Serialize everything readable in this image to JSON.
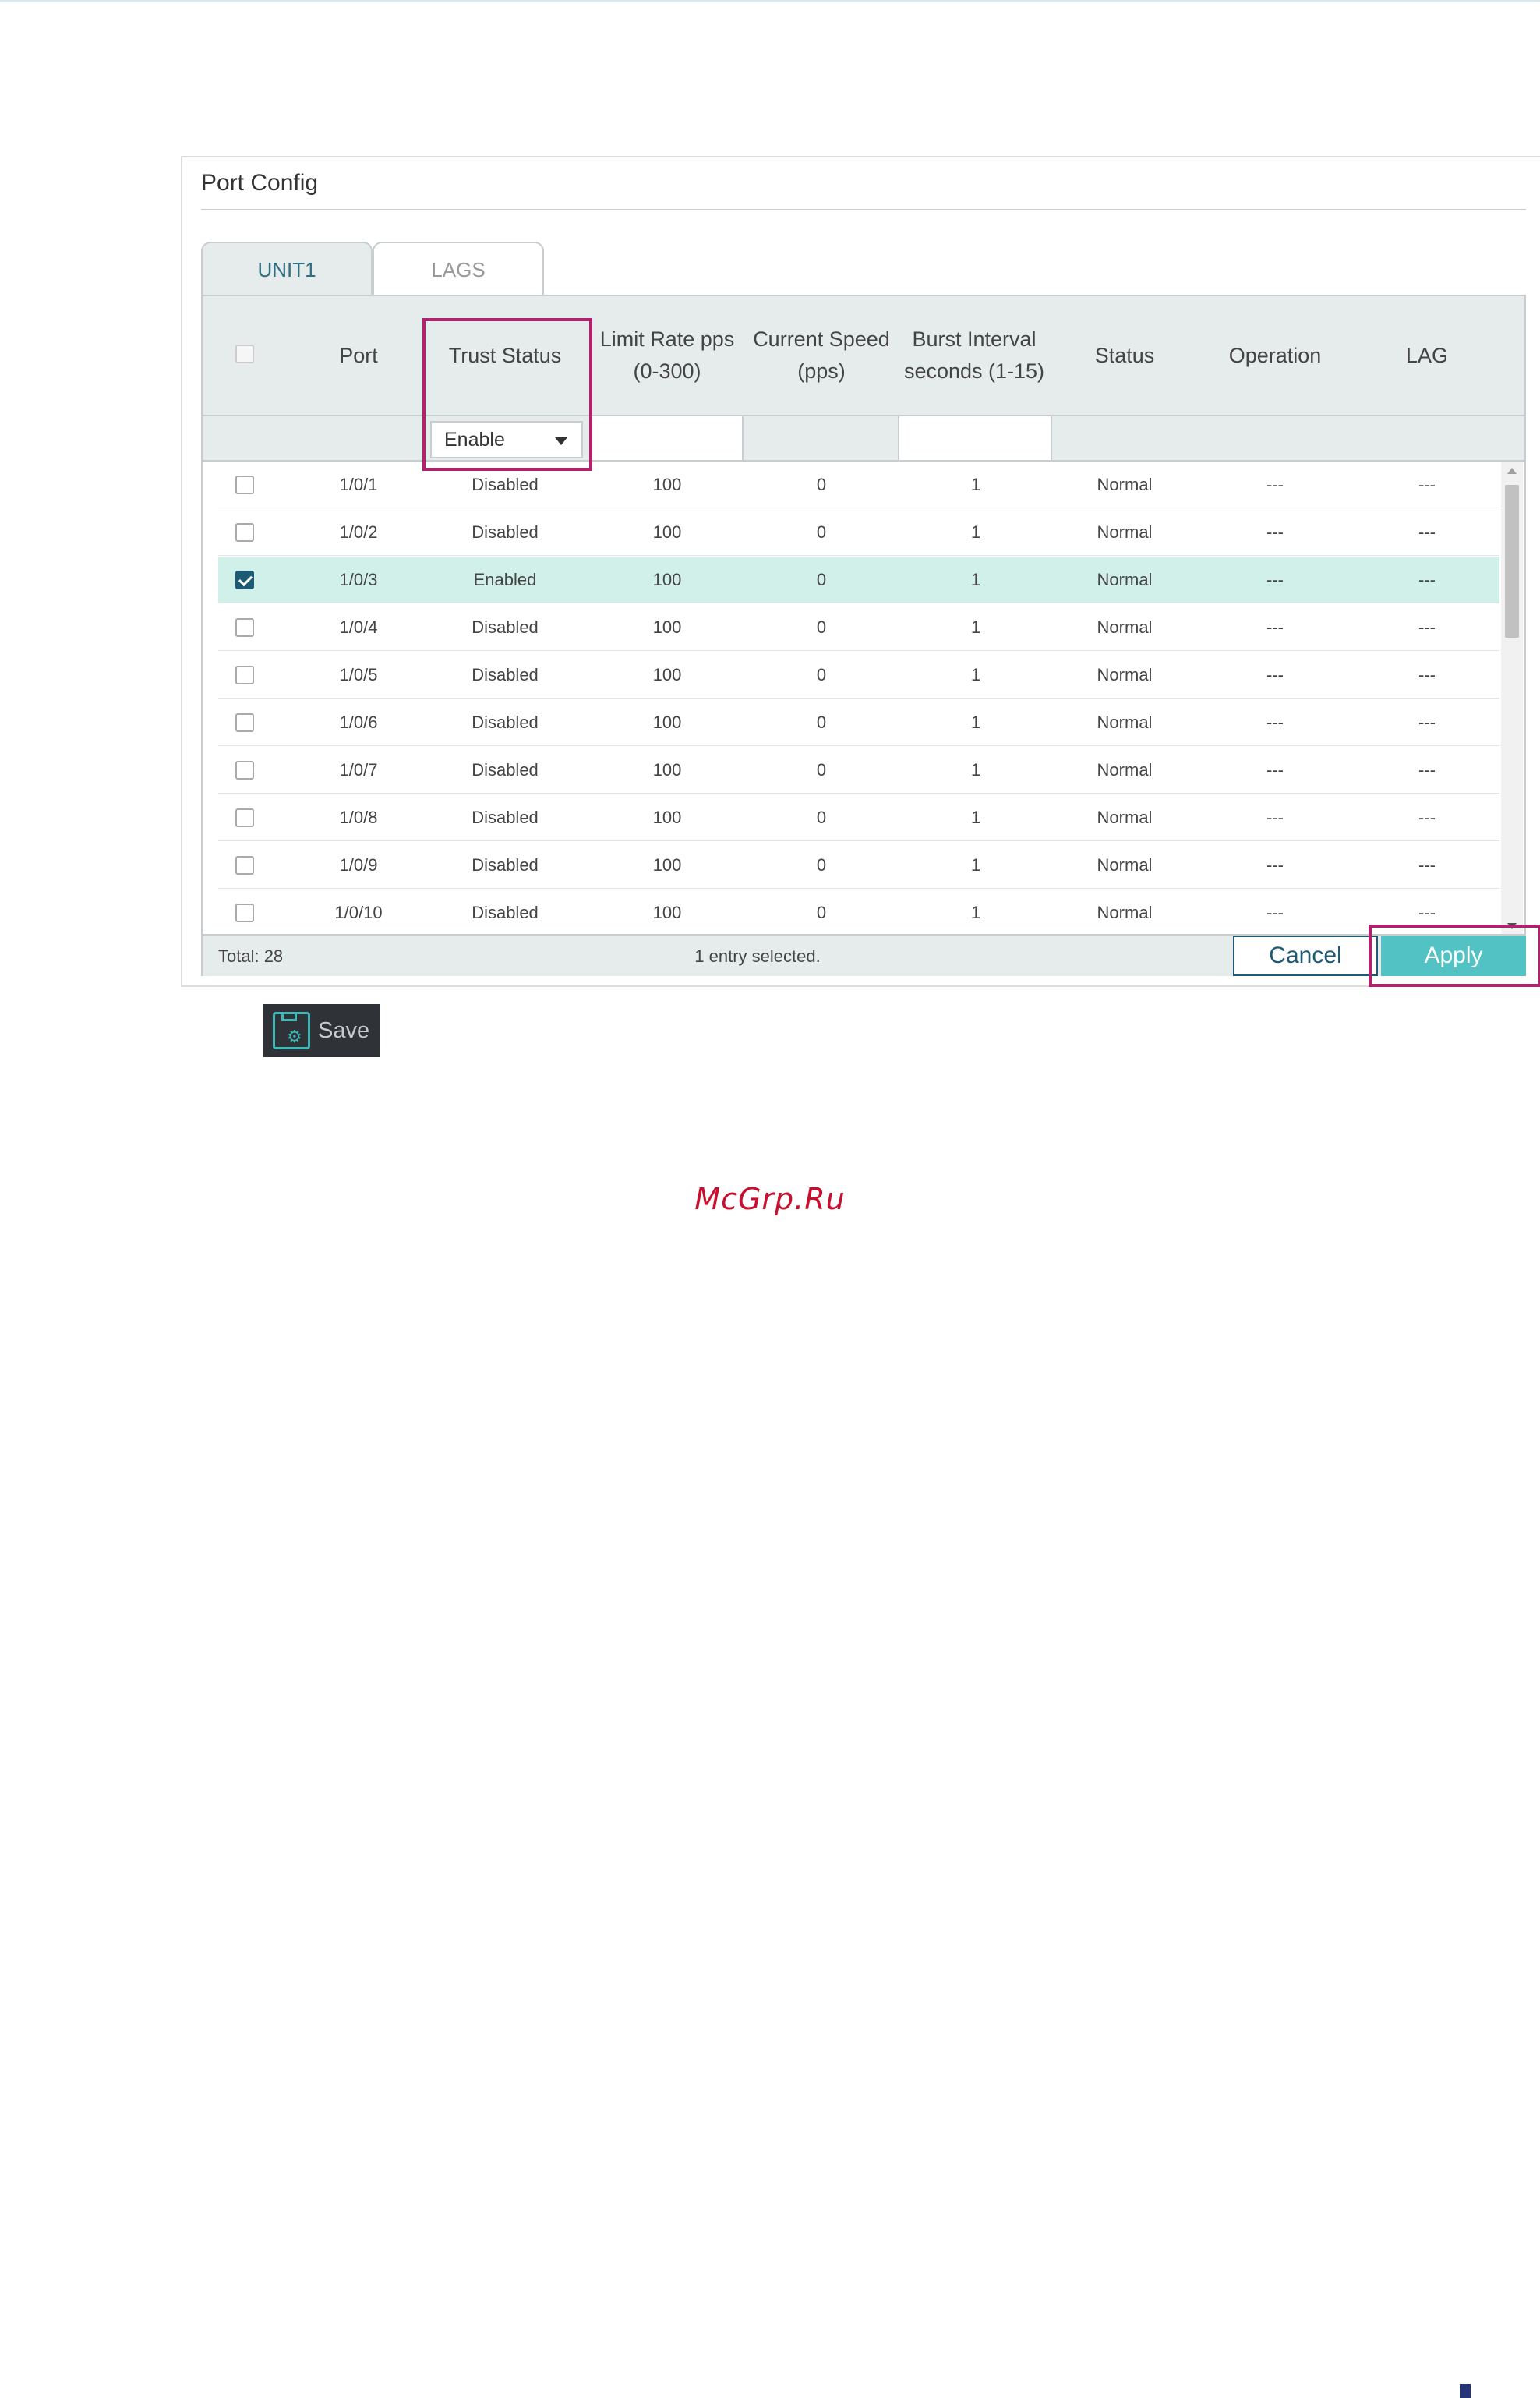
{
  "panel": {
    "title": "Port Config",
    "tabs": [
      {
        "label": "UNIT1",
        "active": true
      },
      {
        "label": "LAGS",
        "active": false
      }
    ]
  },
  "table": {
    "columns": [
      {
        "key": "select",
        "label": ""
      },
      {
        "key": "port",
        "label": "Port"
      },
      {
        "key": "trust_status",
        "label": "Trust Status"
      },
      {
        "key": "limit_rate",
        "label": "Limit Rate pps (0-300)"
      },
      {
        "key": "current_speed",
        "label": "Current Speed (pps)"
      },
      {
        "key": "burst_interval",
        "label": "Burst Interval seconds (1-15)"
      },
      {
        "key": "status",
        "label": "Status"
      },
      {
        "key": "operation",
        "label": "Operation"
      },
      {
        "key": "lag",
        "label": "LAG"
      }
    ],
    "filter": {
      "trust_status_selected": "Enable",
      "limit_rate_value": "",
      "burst_interval_value": ""
    },
    "rows": [
      {
        "checked": false,
        "port": "1/0/1",
        "trust_status": "Disabled",
        "limit_rate": "100",
        "current_speed": "0",
        "burst_interval": "1",
        "status": "Normal",
        "operation": "---",
        "lag": "---"
      },
      {
        "checked": false,
        "port": "1/0/2",
        "trust_status": "Disabled",
        "limit_rate": "100",
        "current_speed": "0",
        "burst_interval": "1",
        "status": "Normal",
        "operation": "---",
        "lag": "---"
      },
      {
        "checked": true,
        "port": "1/0/3",
        "trust_status": "Enabled",
        "limit_rate": "100",
        "current_speed": "0",
        "burst_interval": "1",
        "status": "Normal",
        "operation": "---",
        "lag": "---"
      },
      {
        "checked": false,
        "port": "1/0/4",
        "trust_status": "Disabled",
        "limit_rate": "100",
        "current_speed": "0",
        "burst_interval": "1",
        "status": "Normal",
        "operation": "---",
        "lag": "---"
      },
      {
        "checked": false,
        "port": "1/0/5",
        "trust_status": "Disabled",
        "limit_rate": "100",
        "current_speed": "0",
        "burst_interval": "1",
        "status": "Normal",
        "operation": "---",
        "lag": "---"
      },
      {
        "checked": false,
        "port": "1/0/6",
        "trust_status": "Disabled",
        "limit_rate": "100",
        "current_speed": "0",
        "burst_interval": "1",
        "status": "Normal",
        "operation": "---",
        "lag": "---"
      },
      {
        "checked": false,
        "port": "1/0/7",
        "trust_status": "Disabled",
        "limit_rate": "100",
        "current_speed": "0",
        "burst_interval": "1",
        "status": "Normal",
        "operation": "---",
        "lag": "---"
      },
      {
        "checked": false,
        "port": "1/0/8",
        "trust_status": "Disabled",
        "limit_rate": "100",
        "current_speed": "0",
        "burst_interval": "1",
        "status": "Normal",
        "operation": "---",
        "lag": "---"
      },
      {
        "checked": false,
        "port": "1/0/9",
        "trust_status": "Disabled",
        "limit_rate": "100",
        "current_speed": "0",
        "burst_interval": "1",
        "status": "Normal",
        "operation": "---",
        "lag": "---"
      },
      {
        "checked": false,
        "port": "1/0/10",
        "trust_status": "Disabled",
        "limit_rate": "100",
        "current_speed": "0",
        "burst_interval": "1",
        "status": "Normal",
        "operation": "---",
        "lag": "---"
      }
    ],
    "footer": {
      "total": "Total: 28",
      "selected": "1 entry selected.",
      "cancel_label": "Cancel",
      "apply_label": "Apply"
    }
  },
  "save": {
    "label": "Save",
    "icon": "save-settings-icon"
  },
  "watermark": "McGrp.Ru",
  "colors": {
    "accent": "#52c2c4",
    "brand_dark": "#1e5a73",
    "selected_row": "#d2f0ea",
    "highlight_box": "#b0236c",
    "watermark": "#c8102e"
  }
}
